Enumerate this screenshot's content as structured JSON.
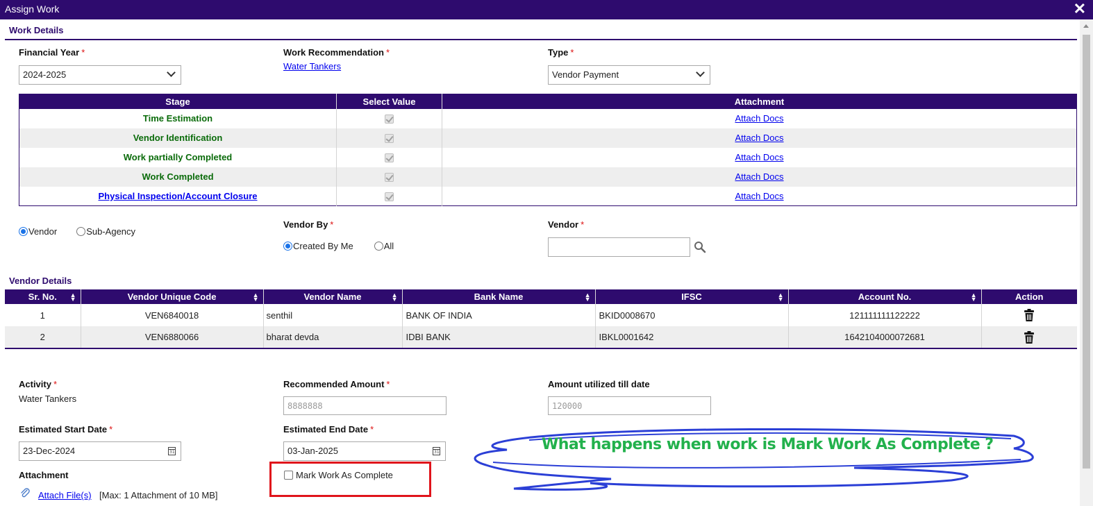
{
  "window": {
    "title": "Assign Work",
    "close_glyph": "✕"
  },
  "work_details": {
    "section_title": "Work Details",
    "financial_year": {
      "label": "Financial Year",
      "value": "2024-2025"
    },
    "work_recommendation": {
      "label": "Work Recommendation",
      "value": "Water Tankers"
    },
    "type": {
      "label": "Type",
      "value": "Vendor Payment"
    },
    "required_mark": "*"
  },
  "stage_table": {
    "headers": [
      "Stage",
      "Select Value",
      "Attachment"
    ],
    "rows": [
      {
        "stage": "Time Estimation",
        "checked": true,
        "attachment": "Attach Docs"
      },
      {
        "stage": "Vendor Identification",
        "checked": true,
        "attachment": "Attach Docs"
      },
      {
        "stage": "Work partially Completed",
        "checked": true,
        "attachment": "Attach Docs"
      },
      {
        "stage": "Work Completed",
        "checked": true,
        "attachment": "Attach Docs"
      },
      {
        "stage": "Physical Inspection/Account Closure",
        "checked": true,
        "attachment": "Attach Docs"
      }
    ]
  },
  "party_type": {
    "options": [
      "Vendor",
      "Sub-Agency"
    ],
    "selected": "Vendor"
  },
  "vendor_by": {
    "label": "Vendor By",
    "options": [
      "Created By Me",
      "All"
    ],
    "selected": "Created By Me"
  },
  "vendor": {
    "label": "Vendor",
    "value": ""
  },
  "vendor_details": {
    "section_title": "Vendor Details",
    "headers": [
      "Sr. No.",
      "Vendor Unique Code",
      "Vendor Name",
      "Bank Name",
      "IFSC",
      "Account No.",
      "Action"
    ],
    "rows": [
      {
        "sr": "1",
        "code": "VEN6840018",
        "name": "senthil",
        "bank": "BANK OF INDIA",
        "ifsc": "BKID0008670",
        "account": "121111111122222"
      },
      {
        "sr": "2",
        "code": "VEN6880066",
        "name": "bharat devda",
        "bank": "IDBI BANK",
        "ifsc": "IBKL0001642",
        "account": "1642104000072681"
      }
    ]
  },
  "activity": {
    "label": "Activity",
    "value": "Water Tankers"
  },
  "recommended_amount": {
    "label": "Recommended Amount",
    "value": "8888888"
  },
  "amount_utilized": {
    "label": "Amount utilized till date",
    "value": "120000"
  },
  "start_date": {
    "label": "Estimated Start Date",
    "value": "23-Dec-2024"
  },
  "end_date": {
    "label": "Estimated End Date",
    "value": "03-Jan-2025"
  },
  "calendar_glyph": "31",
  "attachment": {
    "label": "Attachment",
    "link": "Attach File(s)",
    "note": "[Max: 1 Attachment of 10 MB]"
  },
  "mark_complete": {
    "label": "Mark Work As Complete",
    "checked": false
  },
  "callout": {
    "text": "What happens when work is Mark Work As Complete ?"
  },
  "colors": {
    "header": "#2e0b6e",
    "stage_text": "#0a6b0a",
    "callout_text": "#22b14c",
    "callout_outline": "#2b3fd6",
    "highlight": "#e0141b"
  }
}
